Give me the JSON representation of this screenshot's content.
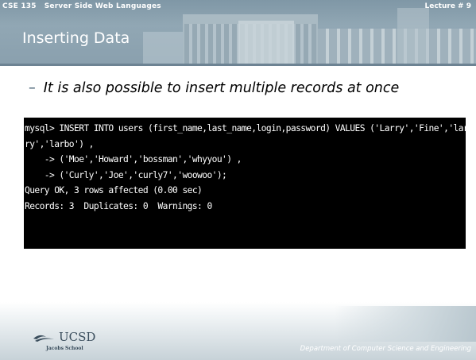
{
  "header": {
    "course": "CSE 135   Server Side Web Languages",
    "lecture": "Lecture # 9",
    "title": "Inserting Data"
  },
  "body": {
    "bullet_marker": "–",
    "bullet_text": "It is also possible to insert multiple records at once"
  },
  "terminal": {
    "lines": [
      "mysql> INSERT INTO users (first_name,last_name,login,password) VALUES ('Larry','Fine','lar",
      "ry','larbo') ,",
      "    -> ('Moe','Howard','bossman','whyyou') ,",
      "    -> ('Curly','Joe','curly7','woowoo');",
      "Query OK, 3 rows affected (0.00 sec)",
      "Records: 3  Duplicates: 0  Warnings: 0"
    ]
  },
  "footer": {
    "logo_text": "UCSD",
    "logo_sub": "Jacobs School",
    "department": "Department of Computer Science and Engineering"
  },
  "colors": {
    "banner": "#8aa0ae",
    "terminal_bg": "#000000",
    "terminal_fg": "#ffffff"
  }
}
